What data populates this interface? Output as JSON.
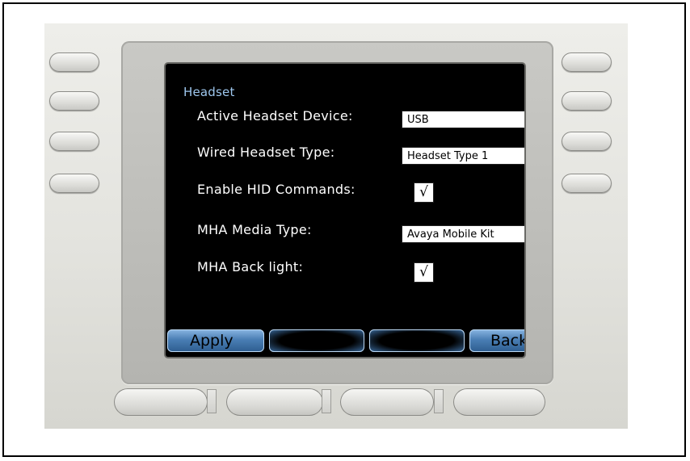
{
  "screen": {
    "title": "Headset",
    "settings": [
      {
        "label": "Active Headset Device:",
        "type": "select",
        "value": "USB"
      },
      {
        "label": "Wired Headset Type:",
        "type": "select",
        "value": "Headset Type 1"
      },
      {
        "label": "Enable HID Commands:",
        "type": "checkbox",
        "value": "√"
      },
      {
        "label": "MHA Media Type:",
        "type": "select",
        "value": "Avaya Mobile Kit"
      },
      {
        "label": "MHA Back light:",
        "type": "checkbox",
        "value": "√"
      }
    ],
    "dropdown_glyph": "▼"
  },
  "softkeys": {
    "key1": "Apply",
    "key2": "",
    "key3": "",
    "key4": "Back"
  },
  "colors": {
    "screen_bg": "#000000",
    "title": "#9ec7ee",
    "softkey_blue": "#4a7eb4"
  }
}
